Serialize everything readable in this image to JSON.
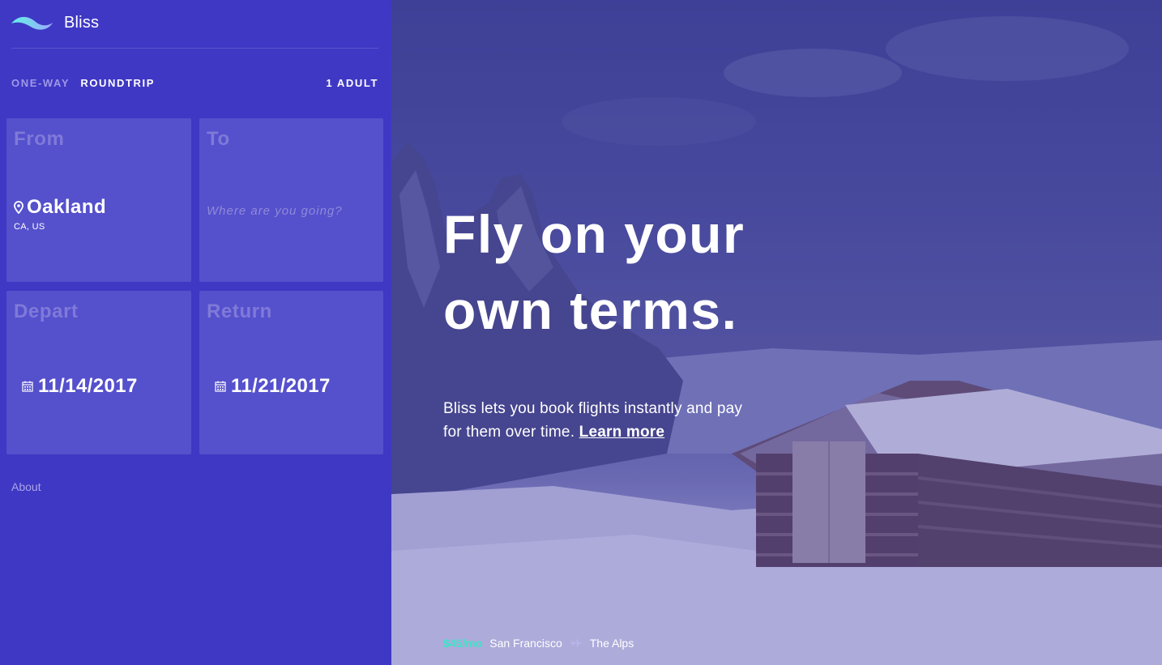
{
  "brand": {
    "name": "Bliss",
    "logo_icon": "wave-logo-icon"
  },
  "trip_type": {
    "one_way": "ONE-WAY",
    "roundtrip": "ROUNDTRIP",
    "selected": "roundtrip"
  },
  "passengers": "1 ADULT",
  "from": {
    "label": "From",
    "city": "Oakland",
    "region": "CA, US",
    "icon": "map-pin-icon"
  },
  "to": {
    "label": "To",
    "value": "",
    "placeholder": "Where are you going?"
  },
  "depart": {
    "label": "Depart",
    "date": "11/14/2017",
    "icon": "calendar-icon"
  },
  "return": {
    "label": "Return",
    "date": "11/21/2017",
    "icon": "calendar-icon"
  },
  "footer": {
    "about": "About"
  },
  "hero": {
    "headline_line1": "Fly on your",
    "headline_line2": "own terms.",
    "subcopy": "Bliss lets you book flights instantly and pay for them over time.",
    "learn_more": "Learn more"
  },
  "deal": {
    "price": "$45/mo",
    "origin": "San Francisco",
    "destination": "The Alps",
    "icon": "plane-icon"
  },
  "colors": {
    "sidebar": "#3f38c4",
    "card": "#5550cc",
    "accent": "#3fe3c8"
  }
}
